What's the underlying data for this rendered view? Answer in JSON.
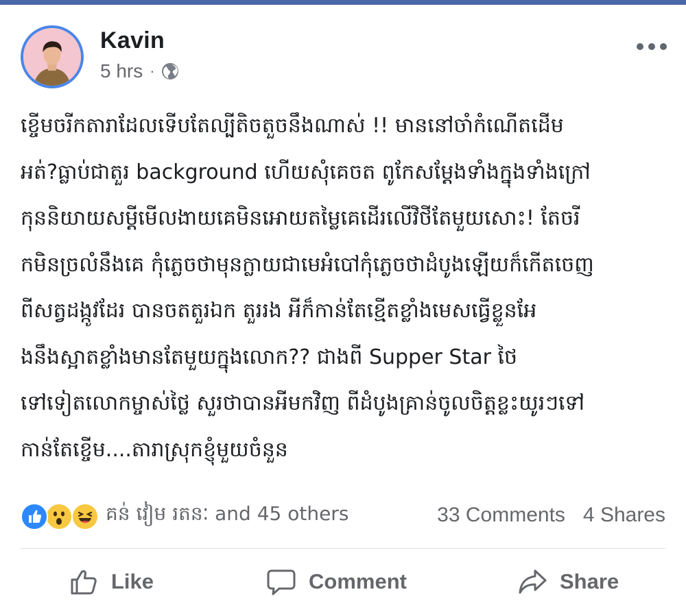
{
  "post": {
    "author": "Kavin",
    "time": "5 hrs",
    "separator": "·",
    "privacy_icon": "globe-icon",
    "more_icon": "more-options-icon",
    "lines": [
      "ខ្ចើមចរីកតារាដែលទើបតែល្បីតិចតួចនឹងណាស់ !! មាននៅចាំកំណើតដើម",
      "អត់?ធ្លាប់ជាតួរ background ហើយសុំគេចត ពូកែសម្តែងទាំងក្នុងទាំងក្រៅ",
      "កុននិយាយសម្តីមើលងាយគេមិនអោយតម្លៃគេដើរលើវិថីតែមួយសោះ! តែចរី",
      "កមិនច្រលំនឹងគេ កុំភ្លេចថាមុនក្លាយជាមេអំបៅកុំភ្លេចថាដំបូងឡើយក៏កើតចេញ",
      "ពីសត្វដង្កូវដែរ បានចតតួរឯក តួររង អីក៏កាន់តែខ្មើតខ្លាំងមេសធ្វើខ្លួនអែ",
      "ងនឹងស្អាតខ្លាំងមានតែមួយក្នុងលោក?? ជាងពី  Supper Star ថៃ",
      "ទៅទៀតលោកម្ចាស់ថ្លៃ សួរថាបានអីមកវិញ ពីដំបូងគ្រាន់ចូលចិត្តខ្លះយូរៗទៅ",
      "កាន់តែខ្ចើម....តារាស្រុកខ្ញុំមួយចំនួន"
    ]
  },
  "reactions": {
    "icons": [
      "like-reaction-icon",
      "wow-reaction-icon",
      "haha-reaction-icon"
    ],
    "names": "គន់ វៀម រតនៈ and 45 others",
    "comments": "33 Comments",
    "shares": "4 Shares"
  },
  "actions": {
    "like": "Like",
    "comment": "Comment",
    "share": "Share"
  },
  "colors": {
    "top_bar": "#4b68a8",
    "avatar_ring": "#4a86e8",
    "like_blue": "#2d88ff",
    "muted_text": "#65676b"
  }
}
